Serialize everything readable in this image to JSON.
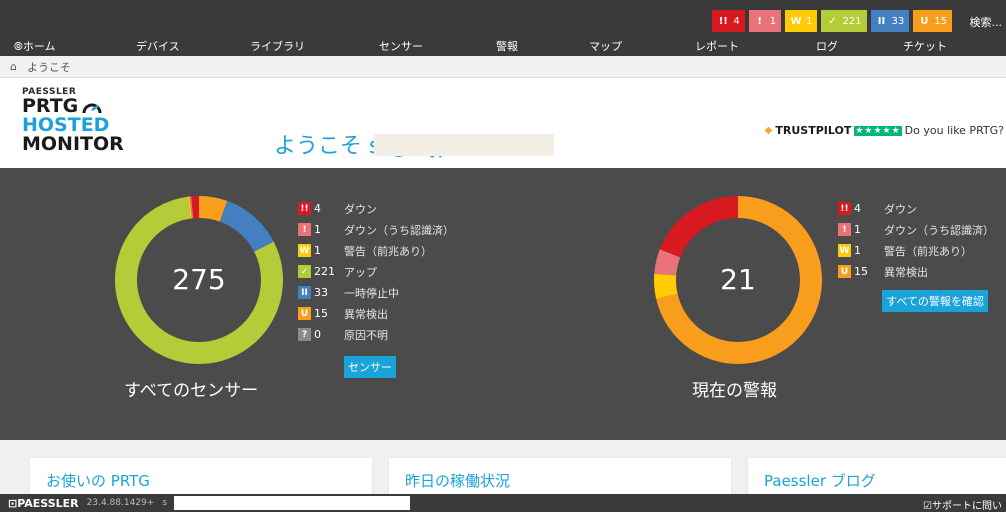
{
  "status": [
    {
      "glyph": "!!",
      "count": "4",
      "color": "#d71920"
    },
    {
      "glyph": "!",
      "count": "1",
      "color": "#e97379"
    },
    {
      "glyph": "W",
      "count": "1",
      "color": "#ffcb05"
    },
    {
      "glyph": "✓",
      "count": "221",
      "color": "#b4cc38"
    },
    {
      "glyph": "II",
      "count": "33",
      "color": "#447fc1"
    },
    {
      "glyph": "U",
      "count": "15",
      "color": "#f99d1c"
    }
  ],
  "search": "検索...",
  "nav": [
    "⦾ホーム",
    "デバイス",
    "ライブラリ",
    "センサー",
    "警報",
    "マップ",
    "レポート",
    "ログ",
    "チケット"
  ],
  "breadcrumb": {
    "home_icon": "home-icon",
    "label": "ようこそ"
  },
  "logo": {
    "l1": "PAESSLER",
    "l2": "PRTG",
    "l3": "HOSTED",
    "l4": "MONITOR"
  },
  "welcome": "ようこそ s                    @it      jp!",
  "trust": {
    "brand": "TRUSTPILOT",
    "stars": "★★★★★",
    "question": "Do you like PRTG?"
  },
  "sensors": {
    "total": "275",
    "title": "すべてのセンサー",
    "button": "センサー",
    "legend": [
      {
        "glyph": "!!",
        "color": "#d71920",
        "count": "4",
        "label": "ダウン"
      },
      {
        "glyph": "!",
        "color": "#e97379",
        "count": "1",
        "label": "ダウン（うち認識済）"
      },
      {
        "glyph": "W",
        "color": "#ffcb05",
        "count": "1",
        "label": "警告（前兆あり）"
      },
      {
        "glyph": "✓",
        "color": "#b4cc38",
        "count": "221",
        "label": "アップ"
      },
      {
        "glyph": "II",
        "color": "#447fc1",
        "count": "33",
        "label": "一時停止中"
      },
      {
        "glyph": "U",
        "color": "#f99d1c",
        "count": "15",
        "label": "異常検出"
      },
      {
        "glyph": "?",
        "color": "#8a8a8a",
        "count": "0",
        "label": "原因不明"
      }
    ]
  },
  "alarms": {
    "total": "21",
    "title": "現在の警報",
    "button": "すべての警報を確認",
    "legend": [
      {
        "glyph": "!!",
        "color": "#d71920",
        "count": "4",
        "label": "ダウン"
      },
      {
        "glyph": "!",
        "color": "#e97379",
        "count": "1",
        "label": "ダウン（うち認識済）"
      },
      {
        "glyph": "W",
        "color": "#ffcb05",
        "count": "1",
        "label": "警告（前兆あり）"
      },
      {
        "glyph": "U",
        "color": "#f99d1c",
        "count": "15",
        "label": "異常検出"
      }
    ]
  },
  "cards": [
    "お使いの PRTG",
    "昨日の稼働状況",
    "Paessler ブログ"
  ],
  "footer": {
    "brand": "⊡PAESSLER",
    "version": "23.4.88.1429+",
    "user": "s",
    "support": "☑サポートに問い"
  }
}
